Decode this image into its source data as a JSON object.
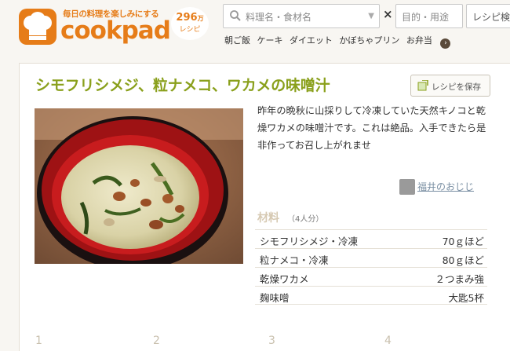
{
  "header": {
    "tagline": "毎日の料理を楽しみにする",
    "brand": "cookpad",
    "recipe_count": "296",
    "recipe_count_suffix": "万",
    "recipe_unit": "レシピ",
    "search_placeholder": "料理名・食材名",
    "times": "×",
    "purpose_placeholder": "目的・用途",
    "search_button": "レシピ検",
    "keywords": [
      "朝ご飯",
      "ケーキ",
      "ダイエット",
      "かぼちゃプリン",
      "お弁当"
    ]
  },
  "recipe": {
    "title": "シモフリシメジ、粒ナメコ、ワカメの味噌汁",
    "save_label": "レシピを保存",
    "description": "昨年の晩秋に山採りして冷凍していた天然キノコと乾燥ワカメの味噌汁です。これは絶品。入手できたら是非作ってお召し上がれませ",
    "author": "福井のおじじ",
    "ingredients_heading": "材料",
    "servings": "（4人分）",
    "ingredients": [
      {
        "name": "シモフリシメジ・冷凍",
        "qty": "70ｇほど"
      },
      {
        "name": "粒ナメコ・冷凍",
        "qty": "80ｇほど"
      },
      {
        "name": "乾燥ワカメ",
        "qty": "２つまみ強"
      },
      {
        "name": "麹味噌",
        "qty": "大匙5杯"
      }
    ],
    "steps": [
      "1",
      "2",
      "3",
      "4"
    ]
  },
  "colors": {
    "brand": "#e67c18",
    "title": "#8aa01c",
    "link": "#7a8fa3"
  }
}
